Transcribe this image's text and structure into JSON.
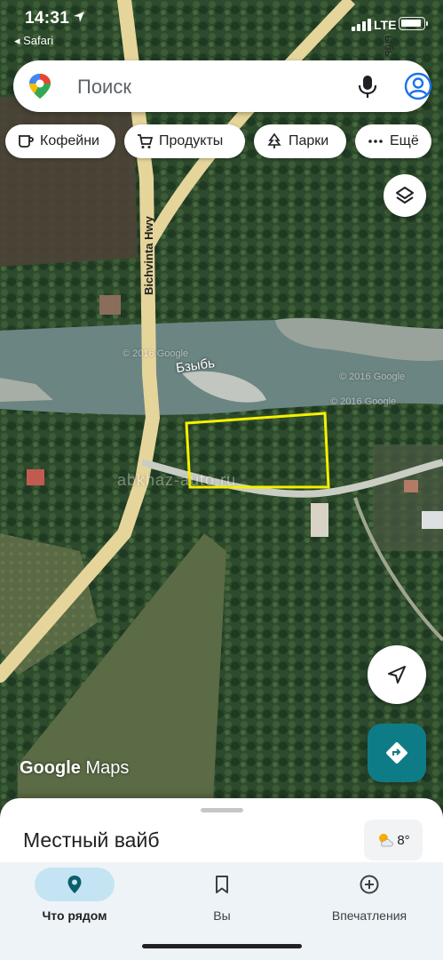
{
  "status_bar": {
    "time": "14:31",
    "back_app": "◂ Safari",
    "network": "LTE"
  },
  "search": {
    "placeholder": "Поиск"
  },
  "chips": [
    {
      "label": "Кофейни",
      "icon": "coffee-icon"
    },
    {
      "label": "Продукты",
      "icon": "cart-icon"
    },
    {
      "label": "Парки",
      "icon": "tree-icon"
    },
    {
      "label": "Ещё",
      "icon": "more-icon"
    }
  ],
  "map": {
    "road_label": "Bichvinta Hwy",
    "river_label": "Бзыбь",
    "corner_label": "ыбь",
    "attribution_1": "© 2016 Google",
    "attribution_2": "© 2016 Google",
    "attribution_3": "© 2016 Google",
    "watermark": "abkhaz-auto.ru",
    "logo_google": "Google",
    "logo_maps": "Maps",
    "highlight_color": "#f5f000"
  },
  "sheet": {
    "title": "Местный вайб",
    "weather": "8°"
  },
  "nav": {
    "items": [
      {
        "label": "Что рядом",
        "icon": "location-pin-icon",
        "active": true
      },
      {
        "label": "Вы",
        "icon": "bookmark-icon",
        "active": false
      },
      {
        "label": "Впечатления",
        "icon": "add-circle-icon",
        "active": false
      }
    ]
  },
  "colors": {
    "accent": "#0e7c86",
    "nav_active": "#c5e4f3",
    "road": "#e6d59b"
  }
}
